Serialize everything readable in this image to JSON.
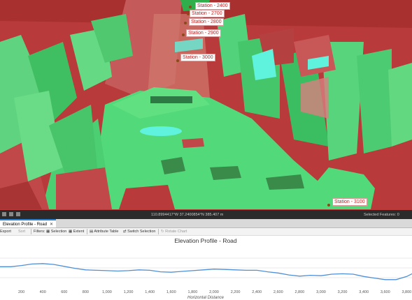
{
  "scene": {
    "stations": [
      {
        "label": "Station - 2400"
      },
      {
        "label": "Station - 2700"
      },
      {
        "label": "Station - 2800"
      },
      {
        "label": "Station - 2900"
      },
      {
        "label": "Station - 3000"
      },
      {
        "label": "Station - 3100"
      }
    ],
    "colors": {
      "terrain_high": "#b83a3a",
      "terrain_low": "#52d97a",
      "water": "#5ff2dc"
    }
  },
  "status_bar": {
    "coordinates": "110.8994417°W 37.2400854°N",
    "elevation": "385.407 m",
    "selected_features": "Selected Features: 0"
  },
  "tab": {
    "label": "Elevation Profile - Road",
    "close": "✕"
  },
  "toolbar": {
    "export": "Export",
    "sort": "Sort",
    "filters": "Filters:",
    "selection": "Selection",
    "extent": "Extent",
    "attribute_table": "Attribute Table",
    "switch_selection": "Switch Selection",
    "rotate_chart": "Rotate Chart"
  },
  "chart_data": {
    "type": "line",
    "title": "Elevation Profile - Road",
    "xlabel": "Horizontal Distance",
    "ylabel": "",
    "x_ticks": [
      "200",
      "400",
      "600",
      "800",
      "1,000",
      "1,200",
      "1,400",
      "1,600",
      "1,800",
      "2,000",
      "2,200",
      "2,400",
      "2,600",
      "2,800",
      "3,000",
      "3,200",
      "3,400",
      "3,600",
      "3,800"
    ],
    "xlim": [
      0,
      3850
    ],
    "ylim": [
      0,
      10
    ],
    "grid": true,
    "series": [
      {
        "color": "#4f8fd6",
        "x": [
          0,
          100,
          200,
          300,
          400,
          500,
          600,
          700,
          800,
          900,
          1000,
          1100,
          1200,
          1300,
          1400,
          1500,
          1600,
          1700,
          1800,
          1900,
          2000,
          2100,
          2200,
          2300,
          2400,
          2500,
          2600,
          2700,
          2800,
          2900,
          3000,
          3100,
          3200,
          3300,
          3400,
          3500,
          3600,
          3700,
          3800,
          3850
        ],
        "y": [
          5.3,
          5.3,
          5.6,
          6.0,
          6.1,
          5.9,
          5.4,
          4.9,
          4.5,
          4.4,
          4.3,
          4.2,
          4.3,
          4.5,
          4.4,
          4.0,
          3.9,
          4.1,
          4.3,
          4.5,
          4.7,
          4.6,
          4.5,
          4.4,
          4.4,
          4.0,
          3.7,
          3.2,
          2.9,
          3.1,
          3.0,
          3.4,
          3.5,
          3.4,
          2.8,
          2.4,
          2.0,
          2.0,
          2.8,
          3.5
        ]
      }
    ]
  }
}
